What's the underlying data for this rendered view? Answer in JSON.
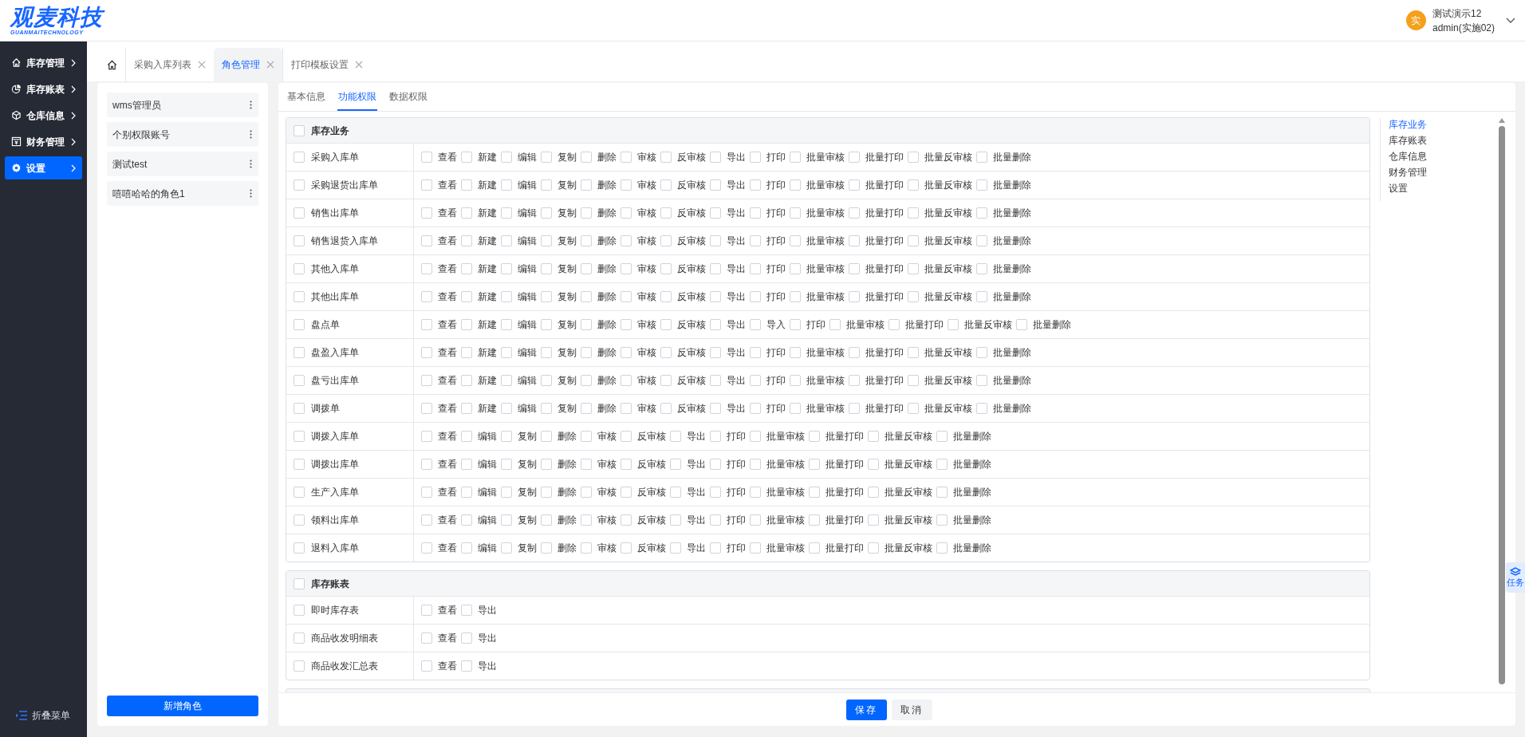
{
  "header": {
    "logo": "观麦科技",
    "logo_subtitle": "GUANMAITECHNOLOGY",
    "user": {
      "avatar": "实",
      "name": "测试演示12",
      "account": "admin(实施02)"
    }
  },
  "sidebar": {
    "items": [
      {
        "label": "库存管理",
        "selected": false
      },
      {
        "label": "库存账表",
        "selected": false
      },
      {
        "label": "仓库信息",
        "selected": false
      },
      {
        "label": "财务管理",
        "selected": false
      },
      {
        "label": "设置",
        "selected": true
      }
    ],
    "collapse": "折叠菜单"
  },
  "page_tabs": [
    {
      "label": "采购入库列表",
      "selected": false
    },
    {
      "label": "角色管理",
      "selected": true
    },
    {
      "label": "打印模板设置",
      "selected": false
    }
  ],
  "roles": {
    "items": [
      {
        "name": "wms管理员"
      },
      {
        "name": "个别权限账号"
      },
      {
        "name": "测试test"
      },
      {
        "name": "嘻嘻哈哈的角色1"
      }
    ],
    "add_button": "新增角色"
  },
  "detail_tabs": [
    {
      "label": "基本信息",
      "selected": false
    },
    {
      "label": "功能权限",
      "selected": true
    },
    {
      "label": "数据权限",
      "selected": false
    }
  ],
  "sections": [
    {
      "title": "库存业务",
      "checked": false,
      "rows": [
        {
          "name": "采购入库单",
          "checked": false,
          "perms": [
            {
              "label": "查看",
              "checked": false
            },
            {
              "label": "新建",
              "checked": false
            },
            {
              "label": "编辑",
              "checked": false
            },
            {
              "label": "复制",
              "checked": false
            },
            {
              "label": "删除",
              "checked": false
            },
            {
              "label": "审核",
              "checked": false
            },
            {
              "label": "反审核",
              "checked": false
            },
            {
              "label": "导出",
              "checked": false
            },
            {
              "label": "打印",
              "checked": false
            },
            {
              "label": "批量审核",
              "checked": false
            },
            {
              "label": "批量打印",
              "checked": false
            },
            {
              "label": "批量反审核",
              "checked": false
            },
            {
              "label": "批量删除",
              "checked": false
            }
          ]
        },
        {
          "name": "采购退货出库单",
          "checked": false,
          "perms": [
            {
              "label": "查看",
              "checked": false
            },
            {
              "label": "新建",
              "checked": false
            },
            {
              "label": "编辑",
              "checked": false
            },
            {
              "label": "复制",
              "checked": false
            },
            {
              "label": "删除",
              "checked": false
            },
            {
              "label": "审核",
              "checked": false
            },
            {
              "label": "反审核",
              "checked": false
            },
            {
              "label": "导出",
              "checked": false
            },
            {
              "label": "打印",
              "checked": false
            },
            {
              "label": "批量审核",
              "checked": false
            },
            {
              "label": "批量打印",
              "checked": false
            },
            {
              "label": "批量反审核",
              "checked": false
            },
            {
              "label": "批量删除",
              "checked": false
            }
          ]
        },
        {
          "name": "销售出库单",
          "checked": false,
          "perms": [
            {
              "label": "查看",
              "checked": false
            },
            {
              "label": "新建",
              "checked": false
            },
            {
              "label": "编辑",
              "checked": false
            },
            {
              "label": "复制",
              "checked": false
            },
            {
              "label": "删除",
              "checked": false
            },
            {
              "label": "审核",
              "checked": false
            },
            {
              "label": "反审核",
              "checked": false
            },
            {
              "label": "导出",
              "checked": false
            },
            {
              "label": "打印",
              "checked": false
            },
            {
              "label": "批量审核",
              "checked": false
            },
            {
              "label": "批量打印",
              "checked": false
            },
            {
              "label": "批量反审核",
              "checked": false
            },
            {
              "label": "批量删除",
              "checked": false
            }
          ]
        },
        {
          "name": "销售退货入库单",
          "checked": false,
          "perms": [
            {
              "label": "查看",
              "checked": false
            },
            {
              "label": "新建",
              "checked": false
            },
            {
              "label": "编辑",
              "checked": false
            },
            {
              "label": "复制",
              "checked": false
            },
            {
              "label": "删除",
              "checked": false
            },
            {
              "label": "审核",
              "checked": false
            },
            {
              "label": "反审核",
              "checked": false
            },
            {
              "label": "导出",
              "checked": false
            },
            {
              "label": "打印",
              "checked": false
            },
            {
              "label": "批量审核",
              "checked": false
            },
            {
              "label": "批量打印",
              "checked": false
            },
            {
              "label": "批量反审核",
              "checked": false
            },
            {
              "label": "批量删除",
              "checked": false
            }
          ]
        },
        {
          "name": "其他入库单",
          "checked": false,
          "perms": [
            {
              "label": "查看",
              "checked": false
            },
            {
              "label": "新建",
              "checked": false
            },
            {
              "label": "编辑",
              "checked": false
            },
            {
              "label": "复制",
              "checked": false
            },
            {
              "label": "删除",
              "checked": false
            },
            {
              "label": "审核",
              "checked": false
            },
            {
              "label": "反审核",
              "checked": false
            },
            {
              "label": "导出",
              "checked": false
            },
            {
              "label": "打印",
              "checked": false
            },
            {
              "label": "批量审核",
              "checked": false
            },
            {
              "label": "批量打印",
              "checked": false
            },
            {
              "label": "批量反审核",
              "checked": false
            },
            {
              "label": "批量删除",
              "checked": false
            }
          ]
        },
        {
          "name": "其他出库单",
          "checked": false,
          "perms": [
            {
              "label": "查看",
              "checked": false
            },
            {
              "label": "新建",
              "checked": false
            },
            {
              "label": "编辑",
              "checked": false
            },
            {
              "label": "复制",
              "checked": false
            },
            {
              "label": "删除",
              "checked": false
            },
            {
              "label": "审核",
              "checked": false
            },
            {
              "label": "反审核",
              "checked": false
            },
            {
              "label": "导出",
              "checked": false
            },
            {
              "label": "打印",
              "checked": false
            },
            {
              "label": "批量审核",
              "checked": false
            },
            {
              "label": "批量打印",
              "checked": false
            },
            {
              "label": "批量反审核",
              "checked": false
            },
            {
              "label": "批量删除",
              "checked": false
            }
          ]
        },
        {
          "name": "盘点单",
          "checked": false,
          "perms": [
            {
              "label": "查看",
              "checked": false
            },
            {
              "label": "新建",
              "checked": false
            },
            {
              "label": "编辑",
              "checked": false
            },
            {
              "label": "复制",
              "checked": false
            },
            {
              "label": "删除",
              "checked": false
            },
            {
              "label": "审核",
              "checked": false
            },
            {
              "label": "反审核",
              "checked": false
            },
            {
              "label": "导出",
              "checked": false
            },
            {
              "label": "导入",
              "checked": false
            },
            {
              "label": "打印",
              "checked": false
            },
            {
              "label": "批量审核",
              "checked": false
            },
            {
              "label": "批量打印",
              "checked": false
            },
            {
              "label": "批量反审核",
              "checked": false
            },
            {
              "label": "批量删除",
              "checked": false
            }
          ]
        },
        {
          "name": "盘盈入库单",
          "checked": false,
          "perms": [
            {
              "label": "查看",
              "checked": false
            },
            {
              "label": "新建",
              "checked": false
            },
            {
              "label": "编辑",
              "checked": false
            },
            {
              "label": "复制",
              "checked": false
            },
            {
              "label": "删除",
              "checked": false
            },
            {
              "label": "审核",
              "checked": false
            },
            {
              "label": "反审核",
              "checked": false
            },
            {
              "label": "导出",
              "checked": false
            },
            {
              "label": "打印",
              "checked": false
            },
            {
              "label": "批量审核",
              "checked": false
            },
            {
              "label": "批量打印",
              "checked": false
            },
            {
              "label": "批量反审核",
              "checked": false
            },
            {
              "label": "批量删除",
              "checked": false
            }
          ]
        },
        {
          "name": "盘亏出库单",
          "checked": false,
          "perms": [
            {
              "label": "查看",
              "checked": false
            },
            {
              "label": "新建",
              "checked": false
            },
            {
              "label": "编辑",
              "checked": false
            },
            {
              "label": "复制",
              "checked": false
            },
            {
              "label": "删除",
              "checked": false
            },
            {
              "label": "审核",
              "checked": false
            },
            {
              "label": "反审核",
              "checked": false
            },
            {
              "label": "导出",
              "checked": false
            },
            {
              "label": "打印",
              "checked": false
            },
            {
              "label": "批量审核",
              "checked": false
            },
            {
              "label": "批量打印",
              "checked": false
            },
            {
              "label": "批量反审核",
              "checked": false
            },
            {
              "label": "批量删除",
              "checked": false
            }
          ]
        },
        {
          "name": "调拨单",
          "checked": false,
          "perms": [
            {
              "label": "查看",
              "checked": false
            },
            {
              "label": "新建",
              "checked": false
            },
            {
              "label": "编辑",
              "checked": false
            },
            {
              "label": "复制",
              "checked": false
            },
            {
              "label": "删除",
              "checked": false
            },
            {
              "label": "审核",
              "checked": false
            },
            {
              "label": "反审核",
              "checked": false
            },
            {
              "label": "导出",
              "checked": false
            },
            {
              "label": "打印",
              "checked": false
            },
            {
              "label": "批量审核",
              "checked": false
            },
            {
              "label": "批量打印",
              "checked": false
            },
            {
              "label": "批量反审核",
              "checked": false
            },
            {
              "label": "批量删除",
              "checked": false
            }
          ]
        },
        {
          "name": "调拨入库单",
          "checked": false,
          "perms": [
            {
              "label": "查看",
              "checked": false
            },
            {
              "label": "编辑",
              "checked": false
            },
            {
              "label": "复制",
              "checked": false
            },
            {
              "label": "删除",
              "checked": false
            },
            {
              "label": "审核",
              "checked": false
            },
            {
              "label": "反审核",
              "checked": false
            },
            {
              "label": "导出",
              "checked": false
            },
            {
              "label": "打印",
              "checked": false
            },
            {
              "label": "批量审核",
              "checked": false
            },
            {
              "label": "批量打印",
              "checked": false
            },
            {
              "label": "批量反审核",
              "checked": false
            },
            {
              "label": "批量删除",
              "checked": false
            }
          ]
        },
        {
          "name": "调拨出库单",
          "checked": false,
          "perms": [
            {
              "label": "查看",
              "checked": false
            },
            {
              "label": "编辑",
              "checked": false
            },
            {
              "label": "复制",
              "checked": false
            },
            {
              "label": "删除",
              "checked": false
            },
            {
              "label": "审核",
              "checked": false
            },
            {
              "label": "反审核",
              "checked": false
            },
            {
              "label": "导出",
              "checked": false
            },
            {
              "label": "打印",
              "checked": false
            },
            {
              "label": "批量审核",
              "checked": false
            },
            {
              "label": "批量打印",
              "checked": false
            },
            {
              "label": "批量反审核",
              "checked": false
            },
            {
              "label": "批量删除",
              "checked": false
            }
          ]
        },
        {
          "name": "生产入库单",
          "checked": false,
          "perms": [
            {
              "label": "查看",
              "checked": false
            },
            {
              "label": "编辑",
              "checked": false
            },
            {
              "label": "复制",
              "checked": false
            },
            {
              "label": "删除",
              "checked": false
            },
            {
              "label": "审核",
              "checked": false
            },
            {
              "label": "反审核",
              "checked": false
            },
            {
              "label": "导出",
              "checked": false
            },
            {
              "label": "打印",
              "checked": false
            },
            {
              "label": "批量审核",
              "checked": false
            },
            {
              "label": "批量打印",
              "checked": false
            },
            {
              "label": "批量反审核",
              "checked": false
            },
            {
              "label": "批量删除",
              "checked": false
            }
          ]
        },
        {
          "name": "领料出库单",
          "checked": false,
          "perms": [
            {
              "label": "查看",
              "checked": false
            },
            {
              "label": "编辑",
              "checked": false
            },
            {
              "label": "复制",
              "checked": false
            },
            {
              "label": "删除",
              "checked": false
            },
            {
              "label": "审核",
              "checked": false
            },
            {
              "label": "反审核",
              "checked": false
            },
            {
              "label": "导出",
              "checked": false
            },
            {
              "label": "打印",
              "checked": false
            },
            {
              "label": "批量审核",
              "checked": false
            },
            {
              "label": "批量打印",
              "checked": false
            },
            {
              "label": "批量反审核",
              "checked": false
            },
            {
              "label": "批量删除",
              "checked": false
            }
          ]
        },
        {
          "name": "退料入库单",
          "checked": false,
          "perms": [
            {
              "label": "查看",
              "checked": false
            },
            {
              "label": "编辑",
              "checked": false
            },
            {
              "label": "复制",
              "checked": false
            },
            {
              "label": "删除",
              "checked": false
            },
            {
              "label": "审核",
              "checked": false
            },
            {
              "label": "反审核",
              "checked": false
            },
            {
              "label": "导出",
              "checked": false
            },
            {
              "label": "打印",
              "checked": false
            },
            {
              "label": "批量审核",
              "checked": false
            },
            {
              "label": "批量打印",
              "checked": false
            },
            {
              "label": "批量反审核",
              "checked": false
            },
            {
              "label": "批量删除",
              "checked": false
            }
          ]
        }
      ]
    },
    {
      "title": "库存账表",
      "checked": false,
      "rows": [
        {
          "name": "即时库存表",
          "checked": false,
          "perms": [
            {
              "label": "查看",
              "checked": false
            },
            {
              "label": "导出",
              "checked": false
            }
          ]
        },
        {
          "name": "商品收发明细表",
          "checked": false,
          "perms": [
            {
              "label": "查看",
              "checked": false
            },
            {
              "label": "导出",
              "checked": false
            }
          ]
        },
        {
          "name": "商品收发汇总表",
          "checked": false,
          "perms": [
            {
              "label": "查看",
              "checked": false
            },
            {
              "label": "导出",
              "checked": false
            }
          ]
        }
      ]
    }
  ],
  "anchor_nav": [
    {
      "label": "库存业务",
      "selected": true
    },
    {
      "label": "库存账表",
      "selected": false
    },
    {
      "label": "仓库信息",
      "selected": false
    },
    {
      "label": "财务管理",
      "selected": false
    },
    {
      "label": "设置",
      "selected": false
    }
  ],
  "task_button": "任务",
  "footer": {
    "save": "保存",
    "cancel": "取消"
  }
}
